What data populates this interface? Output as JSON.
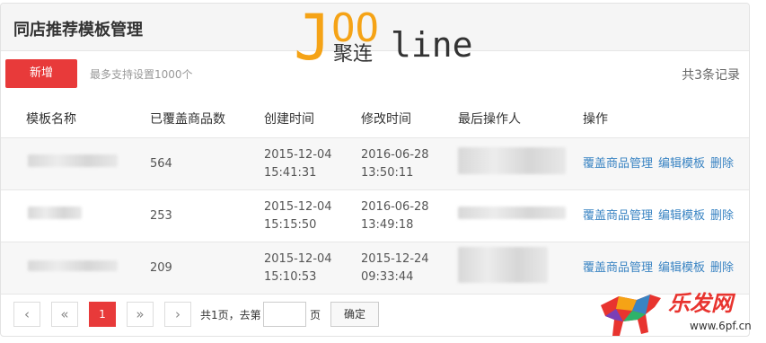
{
  "header": {
    "title": "同店推荐模板管理"
  },
  "logo": {
    "j": "J",
    "oo": "OO",
    "line": "line",
    "cn": "聚连"
  },
  "toolbar": {
    "add_label": "新增",
    "hint": "最多支持设置1000个",
    "record_count": "共3条记录"
  },
  "table": {
    "columns": [
      "模板名称",
      "已覆盖商品数",
      "创建时间",
      "修改时间",
      "最后操作人",
      "操作"
    ],
    "rows": [
      {
        "count": "564",
        "created_date": "2015-12-04",
        "created_time": "15:41:31",
        "modified_date": "2016-06-28",
        "modified_time": "13:50:11"
      },
      {
        "count": "253",
        "created_date": "2015-12-04",
        "created_time": "15:15:50",
        "modified_date": "2016-06-28",
        "modified_time": "13:49:18"
      },
      {
        "count": "209",
        "created_date": "2015-12-04",
        "created_time": "15:10:53",
        "modified_date": "2015-12-24",
        "modified_time": "09:33:44"
      }
    ],
    "actions": {
      "manage": "覆盖商品管理",
      "edit": "编辑模板",
      "delete": "删除"
    }
  },
  "pager": {
    "first_icon": "‹",
    "prev_icon": "«",
    "current": "1",
    "next_icon": "»",
    "last_icon": "›",
    "total_text": "共1页，去第",
    "page_suffix": "页",
    "confirm": "确定"
  },
  "watermark": {
    "site": "乐发网",
    "url": "www.6pf.cn"
  }
}
